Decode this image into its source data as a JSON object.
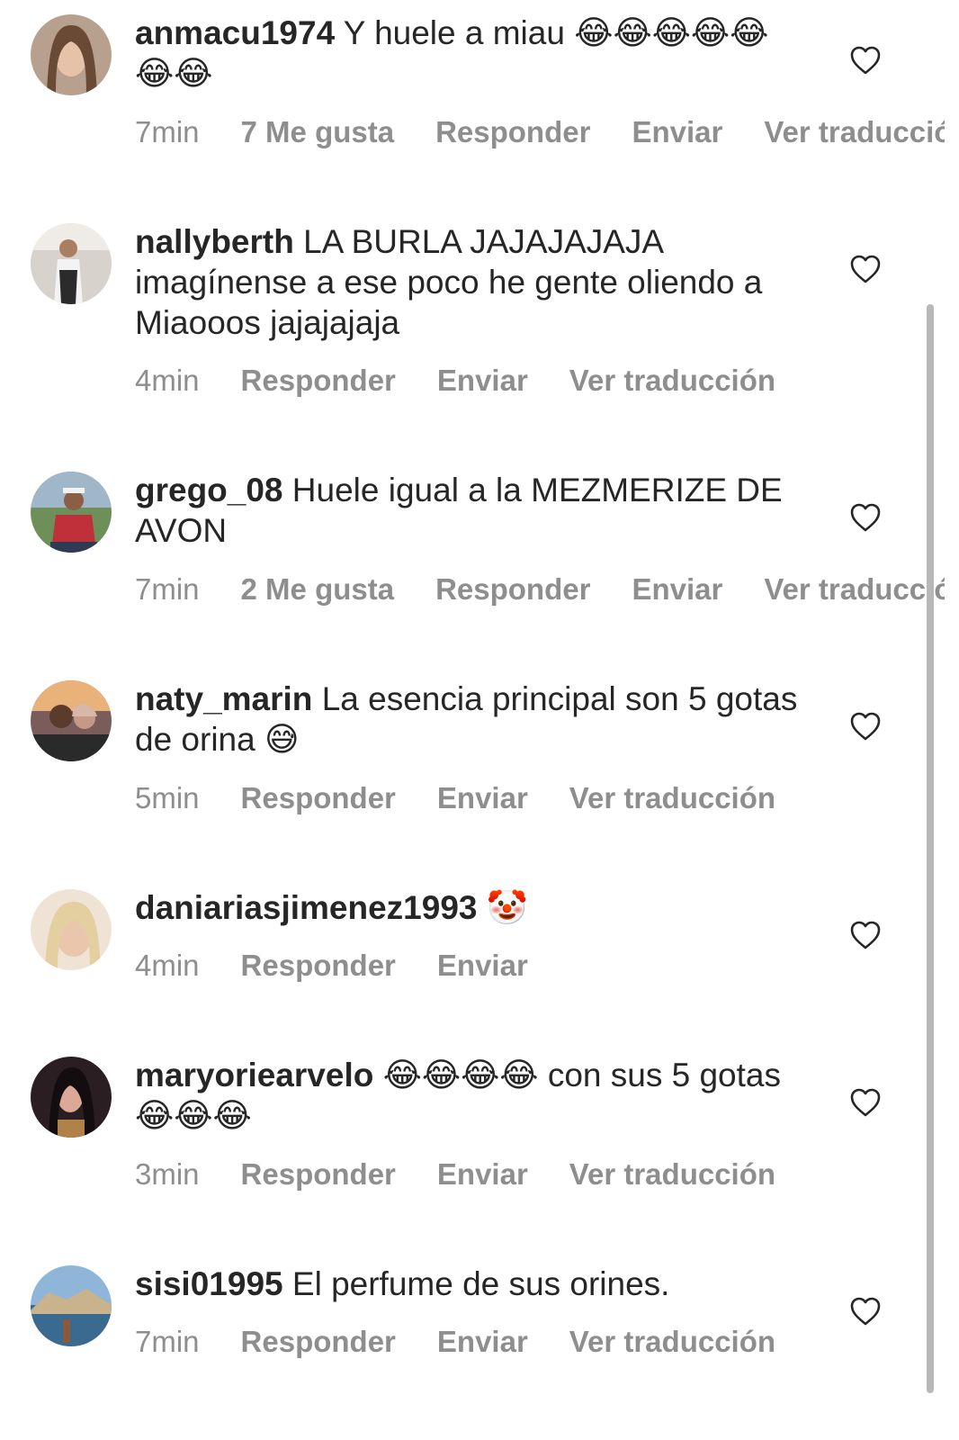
{
  "comments": [
    {
      "username": "anmacu1974",
      "text": "Y huele a miau 😂😂😂😂😂😂😂",
      "time": "7min",
      "likes": "7 Me gusta",
      "reply": "Responder",
      "send": "Enviar",
      "translate": "Ver traducción"
    },
    {
      "username": "nallyberth",
      "text": "LA BURLA JAJAJAJAJA imagínense a ese poco he gente oliendo a Miaooos jajajajaja",
      "time": "4min",
      "reply": "Responder",
      "send": "Enviar",
      "translate": "Ver traducción"
    },
    {
      "username": "grego_08",
      "text": "Huele igual a la MEZMERIZE DE AVON",
      "time": "7min",
      "likes": "2 Me gusta",
      "reply": "Responder",
      "send": "Enviar",
      "translate": "Ver traducción"
    },
    {
      "username": "naty_marin",
      "text": "La esencia principal son 5 gotas de orina 😅",
      "time": "5min",
      "reply": "Responder",
      "send": "Enviar",
      "translate": "Ver traducción"
    },
    {
      "username": "daniariasjimenez1993",
      "text": "🤡",
      "time": "4min",
      "reply": "Responder",
      "send": "Enviar"
    },
    {
      "username": "maryoriearvelo",
      "text": "😂😂😂😂 con sus 5 gotas 😂😂😂",
      "time": "3min",
      "reply": "Responder",
      "send": "Enviar",
      "translate": "Ver traducción"
    },
    {
      "username": "sisi01995",
      "text": "El perfume de sus orines.",
      "time": "7min",
      "reply": "Responder",
      "send": "Enviar",
      "translate": "Ver traducción"
    }
  ],
  "icons": {
    "like": "heart-outline-icon",
    "avatar": "profile-photo"
  },
  "colors": {
    "text": "#262626",
    "meta": "#8e8e8e",
    "background": "#ffffff"
  }
}
